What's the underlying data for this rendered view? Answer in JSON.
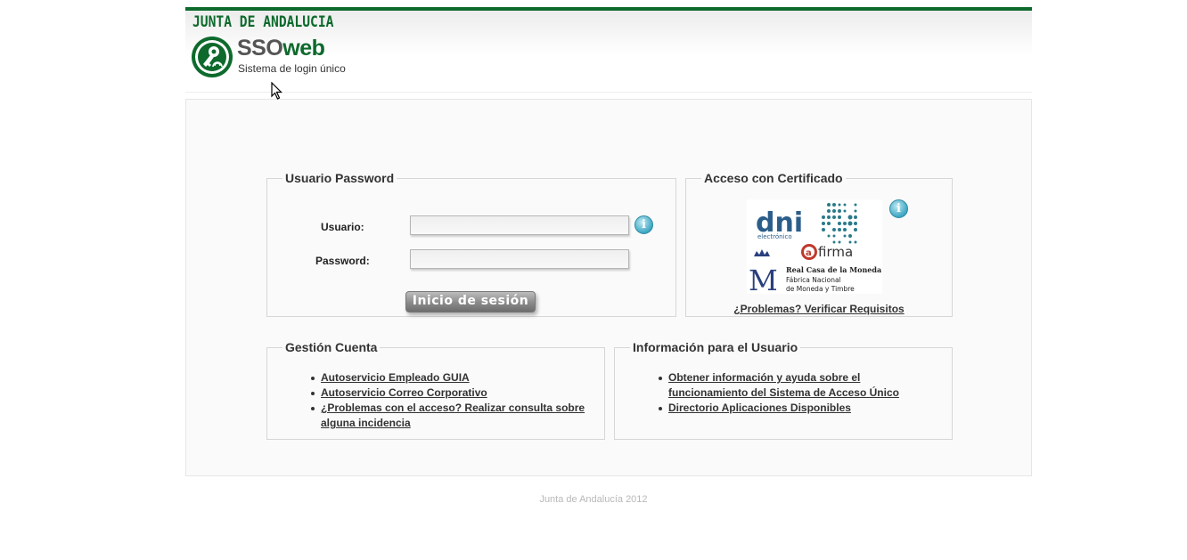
{
  "header": {
    "brand": "JUNTA DE ANDALUCIA",
    "app_title_part1": "SSO",
    "app_title_part2": "web",
    "subtitle": "Sistema de login único"
  },
  "login": {
    "legend": "Usuario Password",
    "username_label": "Usuario:",
    "username_value": "",
    "password_label": "Password:",
    "password_value": "",
    "info_icon_glyph": "i",
    "submit_label": "Inicio de sesión"
  },
  "certificate": {
    "legend": "Acceso con Certificado",
    "dni_text": "dni",
    "dni_sub": "electrónico",
    "afirma_text": "firma",
    "afirma_prefix": "a",
    "fnmt_line1": "Real Casa de la Moneda",
    "fnmt_line2": "Fábrica Nacional",
    "fnmt_line3": "de Moneda y Timbre",
    "fnmt_letter": "M",
    "info_icon_glyph": "i",
    "problems_link": "¿Problemas? Verificar Requisitos"
  },
  "account": {
    "legend": "Gestión Cuenta",
    "links": [
      "Autoservicio Empleado GUIA",
      "Autoservicio Correo Corporativo",
      "¿Problemas con el acceso? Realizar consulta sobre alguna incidencia"
    ]
  },
  "user_info": {
    "legend": "Información para el Usuario",
    "links": [
      "Obtener información y ayuda sobre el funcionamiento del Sistema de Acceso Único",
      "Directorio Aplicaciones Disponibles"
    ]
  },
  "footer": {
    "text": "Junta de Andalucía 2012"
  },
  "colors": {
    "brand_green": "#0d6a2c",
    "info_blue": "#3ea7c3",
    "dni_blue": "#2b5d8a",
    "afirma_red": "#c0392b"
  }
}
